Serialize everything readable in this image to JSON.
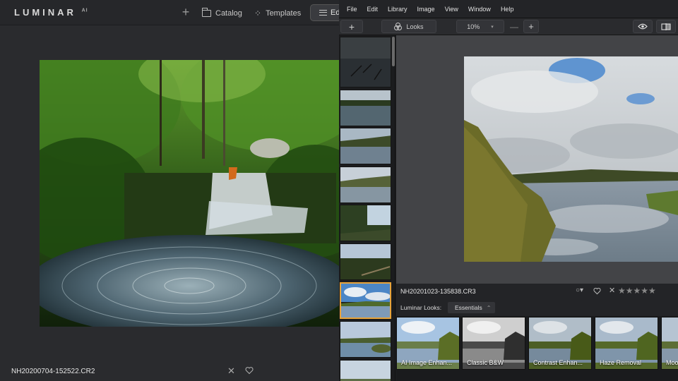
{
  "left_app": {
    "logo": "LUMINAR",
    "logo_suffix": "AI",
    "nav": {
      "catalog": "Catalog",
      "templates": "Templates",
      "edit": "Ed"
    },
    "image_filename": "NH20200704-152522.CR2"
  },
  "right_app": {
    "menu": [
      "File",
      "Edit",
      "Library",
      "Image",
      "View",
      "Window",
      "Help"
    ],
    "toolbar": {
      "looks_label": "Looks",
      "zoom_value": "10%"
    },
    "info": {
      "filename": "NH20201023-135838.CR3",
      "stars": "★★★★★"
    },
    "looks_row": {
      "label": "Luminar Looks:",
      "selected": "Essentials"
    },
    "presets": [
      {
        "label": "AI Image Enhan..."
      },
      {
        "label": "Classic B&W"
      },
      {
        "label": "Contrast Enhan..."
      },
      {
        "label": "Haze Removal"
      },
      {
        "label": "Moo"
      }
    ]
  },
  "colors": {
    "selection_accent": "#e8a33a",
    "panel_dark": "#1e1f21"
  }
}
